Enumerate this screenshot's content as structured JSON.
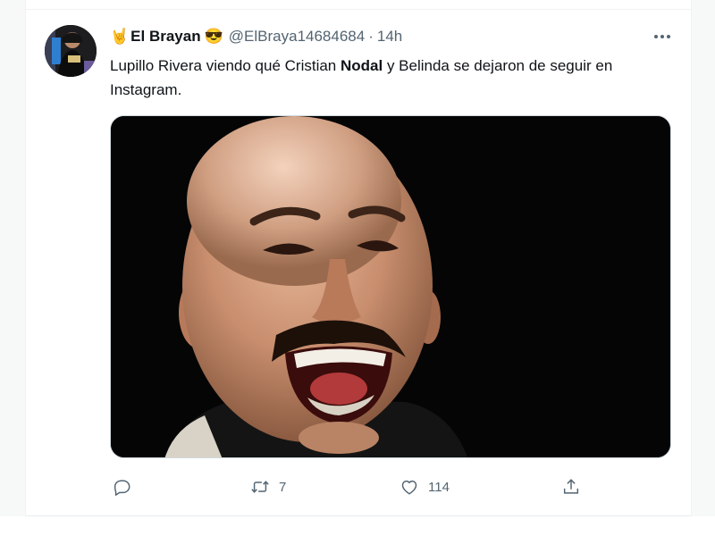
{
  "tweet": {
    "author": {
      "name_emoji": "🤘",
      "display_name": "El Brayan",
      "badge_emoji": "😎",
      "handle": "@ElBraya14684684",
      "separator": "·",
      "time": "14h"
    },
    "text": {
      "part1": "Lupillo Rivera viendo qué Cristian ",
      "bold": "Nodal",
      "part2": "  y Belinda se dejaron de seguir en Instagram."
    },
    "actions": {
      "reply_count": "",
      "retweet_count": "7",
      "like_count": "114"
    },
    "more_icon": "ellipsis-icon"
  },
  "colors": {
    "text_primary": "#0f1419",
    "text_secondary": "#536471",
    "border": "#eff3f4",
    "media_bg": "#050505"
  }
}
